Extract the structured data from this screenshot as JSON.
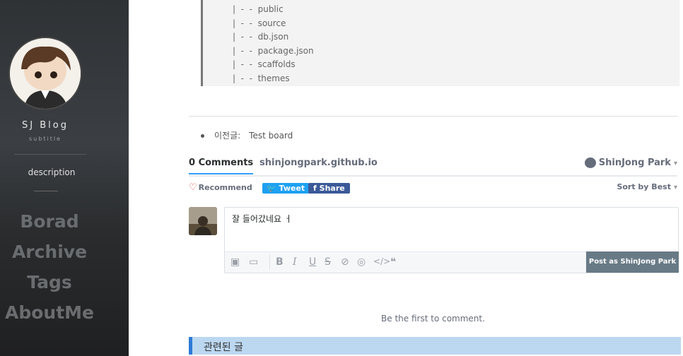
{
  "sidebar": {
    "title": "SJ Blog",
    "subtitle": "subtitle",
    "description": "description",
    "nav": [
      "Borad",
      "Archive",
      "Tags",
      "AboutMe"
    ]
  },
  "code_block": {
    "lines": [
      "|  -  -  public",
      "|  -  -  source",
      "|  -  -  db.json",
      "|  -  -  package.json",
      "|  -  -  scaffolds",
      "|  -  -  themes"
    ]
  },
  "post_nav": {
    "prev_label": "이전글:",
    "prev_title": "Test board"
  },
  "comments": {
    "tab_comments": "0 Comments",
    "tab_site": "shinjongpark.github.io",
    "user_name": "ShinJong Park",
    "recommend": "Recommend",
    "tweet": "Tweet",
    "share": "Share",
    "sort": "Sort by Best",
    "draft": "잘 들어갔네요 ㅓ",
    "post_button": "Post as ShinJong Park",
    "empty_text": "Be the first to comment."
  },
  "related": {
    "title": "관련된 글"
  },
  "colors": {
    "accent": "#2e9fff",
    "tweet": "#1da1f2",
    "facebook": "#3b5998",
    "related_bg": "#bcd7f0"
  }
}
